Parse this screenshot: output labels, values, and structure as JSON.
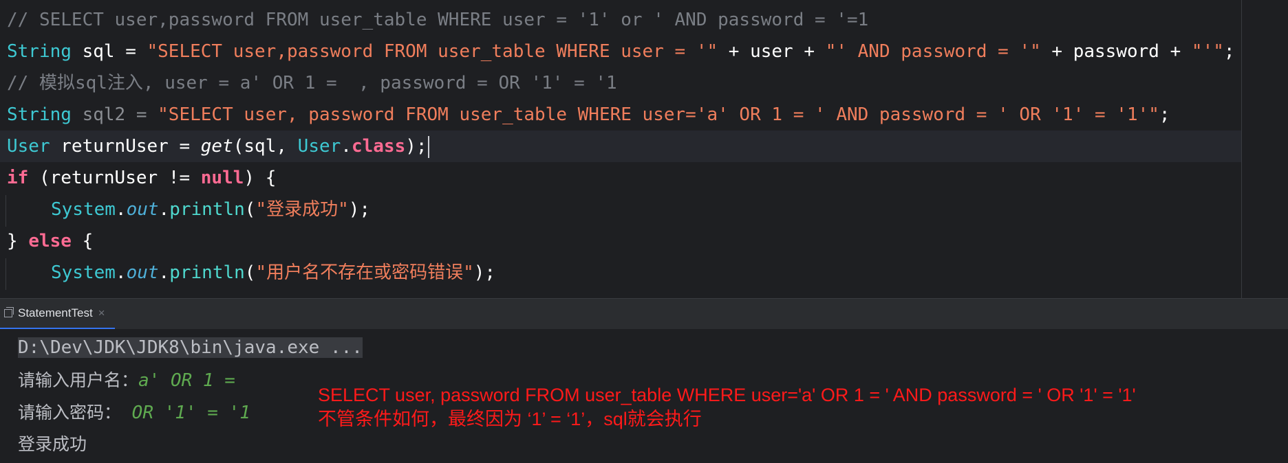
{
  "code_lines": {
    "l1": "// SELECT user,password FROM user_table WHERE user = '1' or ' AND password = '=1",
    "l2_a": "String",
    "l2_b": " sql = ",
    "l2_c": "\"SELECT user,password FROM user_table WHERE user = '\"",
    "l2_d": " + user + ",
    "l2_e": "\"' AND password = '\"",
    "l2_f": " + password + ",
    "l2_g": "\"'\"",
    "l2_h": ";",
    "l3_a": "// 模拟sql注入, user = a' OR 1 = ",
    "l3_b": " , password = OR '1' = '1",
    "l4_a": "String",
    "l4_b": " sql2 = ",
    "l4_c": "\"SELECT user, password FROM user_table WHERE user='a' OR 1 = ' AND password = ' OR '1' = '1'\"",
    "l4_d": ";",
    "l5_a": "User",
    "l5_b": " returnUser = ",
    "l5_c": "get",
    "l5_d": "(sql, ",
    "l5_e": "User",
    "l5_f": ".",
    "l5_g": "class",
    "l5_h": ");",
    "l6_a": "if",
    "l6_b": " (returnUser != ",
    "l6_c": "null",
    "l6_d": ") {",
    "l7_a": "System",
    "l7_b": ".",
    "l7_c": "out",
    "l7_d": ".",
    "l7_e": "println",
    "l7_f": "(",
    "l7_g": "\"登录成功\"",
    "l7_h": ");",
    "l8_a": "} ",
    "l8_b": "else",
    "l8_c": " {",
    "l9_a": "System",
    "l9_b": ".",
    "l9_c": "out",
    "l9_d": ".",
    "l9_e": "println",
    "l9_f": "(",
    "l9_g": "\"用户名不存在或密码错误\"",
    "l9_h": ");"
  },
  "run_tab": {
    "label": "StatementTest",
    "close": "×"
  },
  "console": {
    "command": "D:\\Dev\\JDK\\JDK8\\bin\\java.exe ...",
    "prompt_user": "请输入用户名：",
    "input_user": "a' OR 1 =",
    "prompt_password": "请输入密码：",
    "input_password": " OR '1' = '1",
    "result": "登录成功"
  },
  "annotation": {
    "line1": "SELECT user, password FROM user_table WHERE user='a' OR 1 = ' AND password = ' OR '1' = '1'",
    "line2": "不管条件如何，最终因为 ‘1’ = ‘1’，sql就会执行"
  },
  "colors": {
    "background": "#1e1f22",
    "string": "#f07e5c",
    "keyword": "#cf8e6d",
    "type": "#3ec9d3",
    "comment": "#7a7e85",
    "annotation": "#ff1a1a",
    "console_input": "#5faa50"
  }
}
